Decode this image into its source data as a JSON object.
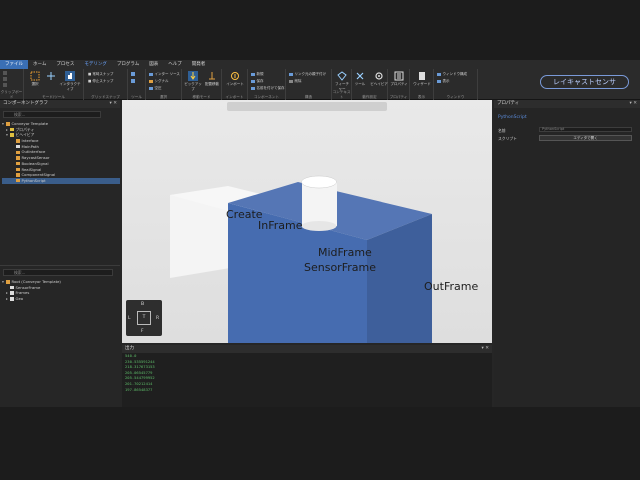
{
  "menu": {
    "tabs": [
      "ファイル",
      "ホーム",
      "プロセス",
      "モデリング",
      "プログラム",
      "図表",
      "ヘルプ",
      "開発者"
    ]
  },
  "ribbon": {
    "groups": [
      {
        "label": "クリップボード"
      },
      {
        "label": "モード/ツール"
      },
      {
        "label": "グリッドスナップ"
      },
      {
        "label": "ツール"
      },
      {
        "label": "選択"
      },
      {
        "label": "移動モード"
      },
      {
        "label": "インポート"
      },
      {
        "label": "コンポーネント"
      },
      {
        "label": "構造"
      },
      {
        "label": "コンテキスト"
      },
      {
        "label": "動作設定"
      },
      {
        "label": "プロパティ"
      },
      {
        "label": "表示"
      },
      {
        "label": "ウィンドウ"
      }
    ],
    "buttons": {
      "select": "選択",
      "interactive": "インタラクティブ",
      "snap_align": "■ 常時スナップ",
      "snap_grid": "■ 停止スナップ",
      "inter_source": "インター ソース",
      "signal": "シグナル",
      "pneumatic": "空圧",
      "pickup": "ピックアップ",
      "place_move": "配置移動",
      "import": "インポート",
      "new": "新規",
      "save": "保存",
      "save_as": "名前を付けて保存",
      "link_parent": "リンク元の親子付け",
      "remove": "削除",
      "feature": "フィーチャー",
      "tool": "ツール",
      "behavior": "ビヘイビア",
      "props": "プロパティ",
      "wizard": "ウィザード",
      "window_layout": "ウィンドウ構成",
      "display": "表示"
    },
    "raycast_label": "レイキャストセンサ"
  },
  "component_graph": {
    "title": "コンポーネントグラフ",
    "search_placeholder": "検索...",
    "items": [
      {
        "label": "Conveyor Template",
        "depth": 0,
        "selected": false
      },
      {
        "label": "プロパティ",
        "depth": 1,
        "selected": false
      },
      {
        "label": "ビヘイビア",
        "depth": 1,
        "selected": false
      },
      {
        "label": "Interface",
        "depth": 2,
        "selected": false
      },
      {
        "label": "MainPath",
        "depth": 2,
        "selected": false
      },
      {
        "label": "OutInterface",
        "depth": 2,
        "selected": false
      },
      {
        "label": "RaycastSensor",
        "depth": 2,
        "selected": false
      },
      {
        "label": "BooleanSignal",
        "depth": 2,
        "selected": false
      },
      {
        "label": "RealSignal",
        "depth": 2,
        "selected": false
      },
      {
        "label": "ComponentSignal",
        "depth": 2,
        "selected": false
      },
      {
        "label": "PythonScript",
        "depth": 2,
        "selected": true
      }
    ]
  },
  "node_tree": {
    "search_placeholder": "検索...",
    "items": [
      {
        "label": "Root (Conveyor Template)",
        "depth": 0
      },
      {
        "label": "SensorFrame",
        "depth": 1
      },
      {
        "label": "Frames",
        "depth": 1
      },
      {
        "label": "Geo",
        "depth": 1
      }
    ]
  },
  "viewport": {
    "frame_labels": {
      "create": "Create",
      "inframe": "InFrame",
      "midframe": "MidFrame",
      "sensorframe": "SensorFrame",
      "outframe": "OutFrame"
    },
    "nav_cube": {
      "top": "B",
      "left": "L",
      "center": "T",
      "right": "R",
      "bottom": "F"
    }
  },
  "output": {
    "title": "出力",
    "lines": [
      "540.0",
      "230.535591244",
      "218.317673153",
      "205.06545779",
      "205.544799952",
      "201.70212414",
      "197.86548377"
    ]
  },
  "properties": {
    "title": "プロパティ",
    "component": "PythonScript",
    "name_label": "名前",
    "name_value": "PythonScript",
    "script_label": "スクリプト",
    "script_button": "エディタで開く"
  },
  "colors": {
    "accent": "#3a6fb5",
    "box_blue": "#4a72b8",
    "output_green": "#5fbf6a"
  }
}
